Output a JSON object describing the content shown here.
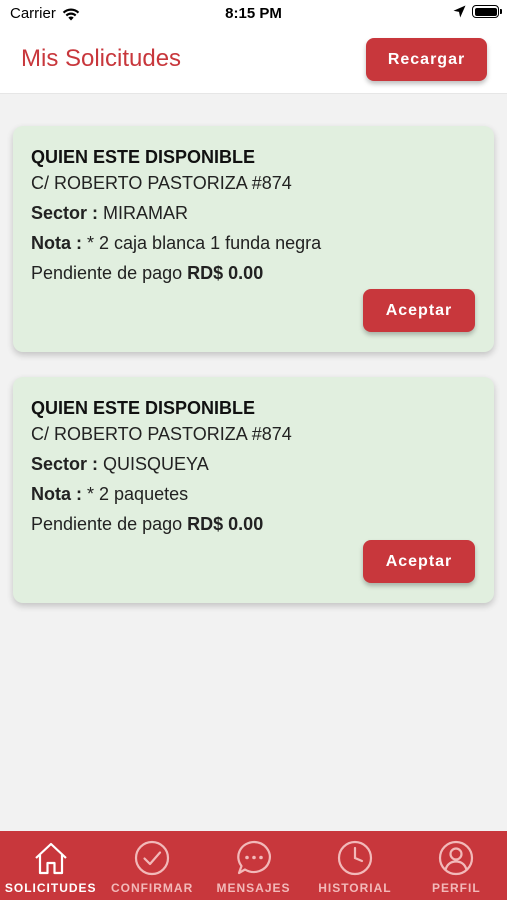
{
  "status_bar": {
    "carrier": "Carrier",
    "time": "8:15 PM",
    "icons": [
      "wifi-icon",
      "location-arrow-icon",
      "battery-icon"
    ]
  },
  "header": {
    "title": "Mis Solicitudes",
    "reload_label": "Recargar"
  },
  "requests": [
    {
      "name": "QUIEN ESTE DISPONIBLE",
      "address": "C/ ROBERTO PASTORIZA #874",
      "sector_label": "Sector :",
      "sector": "MIRAMAR",
      "note_label": "Nota :",
      "note": "* 2 caja blanca 1 funda negra",
      "pending_label": "Pendiente de pago",
      "amount": "RD$ 0.00",
      "accept_label": "Aceptar"
    },
    {
      "name": "QUIEN ESTE DISPONIBLE",
      "address": "C/ ROBERTO PASTORIZA #874",
      "sector_label": "Sector :",
      "sector": "QUISQUEYA",
      "note_label": "Nota :",
      "note": "* 2 paquetes",
      "pending_label": "Pendiente de pago",
      "amount": "RD$ 0.00",
      "accept_label": "Aceptar"
    }
  ],
  "tabs": [
    {
      "label": "SOLICITUDES",
      "icon": "home-icon",
      "active": true
    },
    {
      "label": "CONFIRMAR",
      "icon": "check-circle-icon",
      "active": false
    },
    {
      "label": "MENSAJES",
      "icon": "chat-bubble-icon",
      "active": false
    },
    {
      "label": "HISTORIAL",
      "icon": "clock-icon",
      "active": false
    },
    {
      "label": "PERFIL",
      "icon": "user-icon",
      "active": false
    }
  ],
  "colors": {
    "brand": "#c8373c",
    "card_bg": "#e1efdf",
    "page_bg": "#f2f2f2"
  }
}
